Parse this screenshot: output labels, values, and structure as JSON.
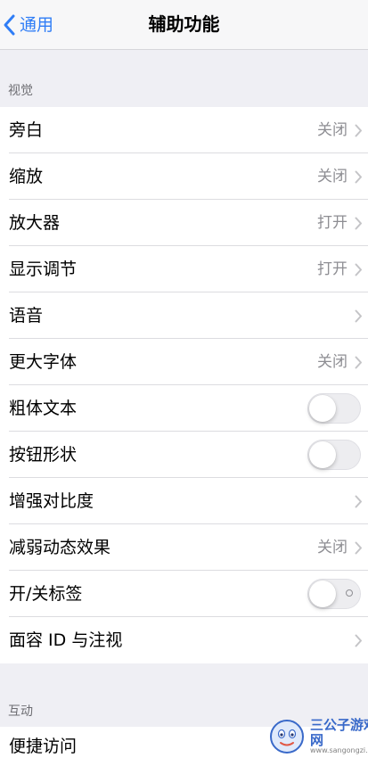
{
  "nav": {
    "back_label": "通用",
    "title": "辅助功能"
  },
  "sections": [
    {
      "header": "视觉",
      "rows": [
        {
          "label": "旁白",
          "value": "关闭",
          "type": "link"
        },
        {
          "label": "缩放",
          "value": "关闭",
          "type": "link"
        },
        {
          "label": "放大器",
          "value": "打开",
          "type": "link"
        },
        {
          "label": "显示调节",
          "value": "打开",
          "type": "link"
        },
        {
          "label": "语音",
          "value": "",
          "type": "link"
        },
        {
          "label": "更大字体",
          "value": "关闭",
          "type": "link"
        },
        {
          "label": "粗体文本",
          "value": "",
          "type": "toggle",
          "toggle_on": false
        },
        {
          "label": "按钮形状",
          "value": "",
          "type": "toggle",
          "toggle_on": false
        },
        {
          "label": "增强对比度",
          "value": "",
          "type": "link"
        },
        {
          "label": "减弱动态效果",
          "value": "关闭",
          "type": "link"
        },
        {
          "label": "开/关标签",
          "value": "",
          "type": "toggle",
          "toggle_on": false
        },
        {
          "label": "面容 ID 与注视",
          "value": "",
          "type": "link"
        }
      ]
    },
    {
      "header": "互动",
      "rows": [
        {
          "label": "便捷访问",
          "value": "",
          "type": "link"
        }
      ]
    }
  ],
  "watermark": {
    "title": "三公子游戏网",
    "url": "www.sangongzi.net"
  },
  "colors": {
    "accent": "#2f7df6",
    "background": "#efeff4",
    "secondary_text": "#8e8e93"
  },
  "icons": {
    "back": "chevron-left-icon",
    "row_disclosure": "chevron-right-icon"
  }
}
